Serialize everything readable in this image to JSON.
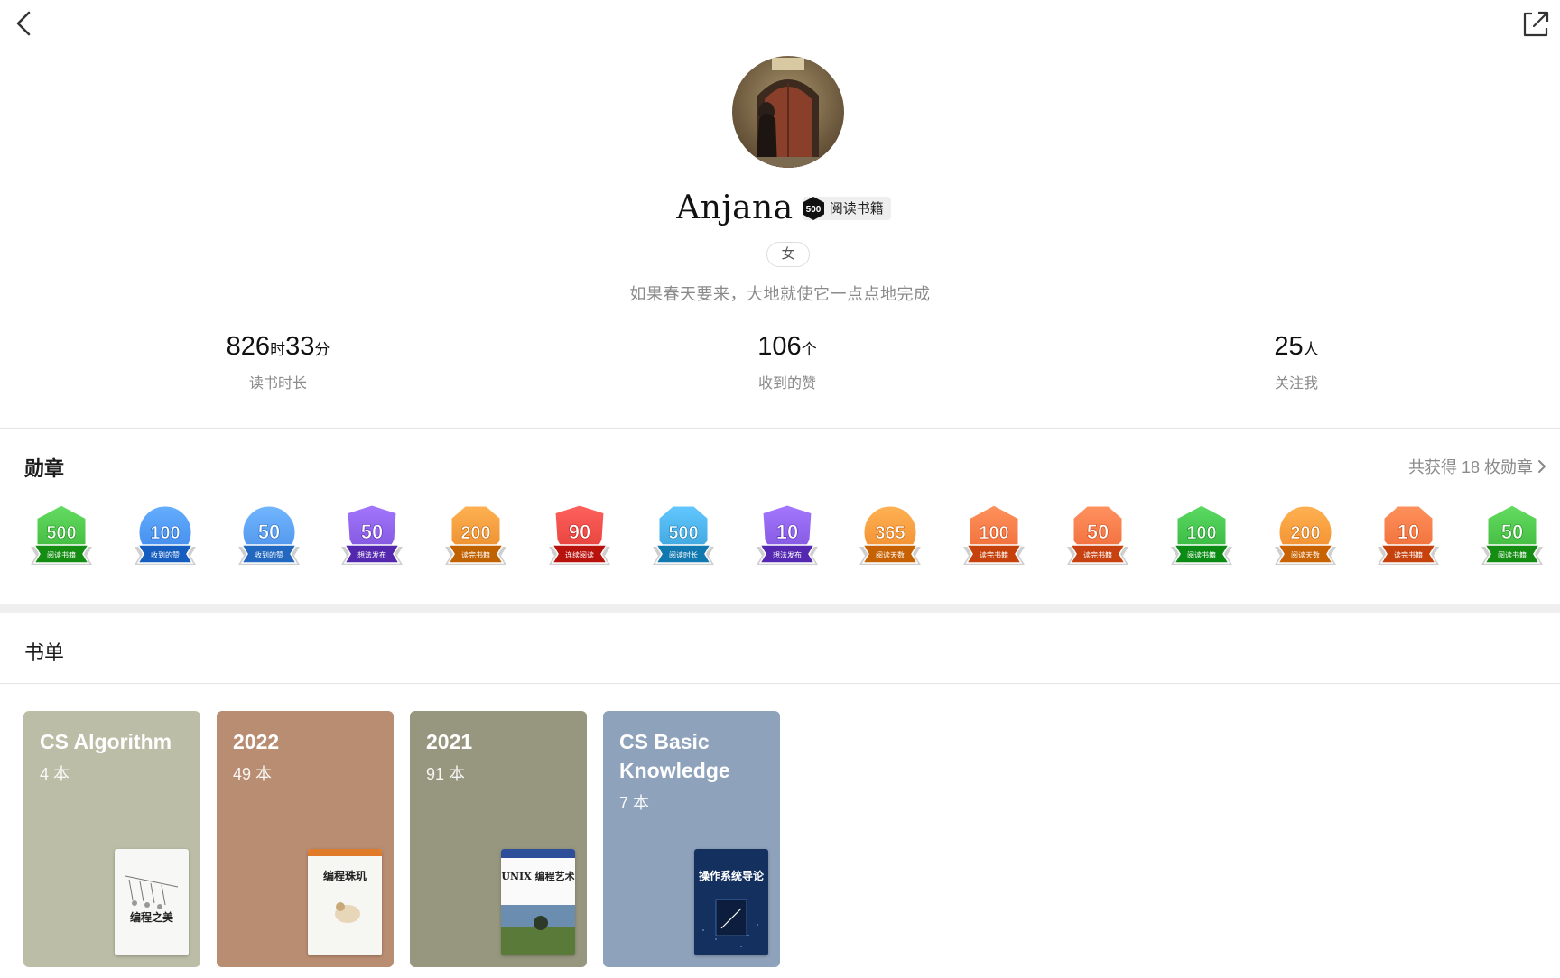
{
  "profile": {
    "name": "Anjana",
    "badge_number": "500",
    "badge_label": "阅读书籍",
    "gender": "女",
    "motto": "如果春天要来，大地就使它一点点地完成"
  },
  "stats": [
    {
      "value": "826",
      "unit1": "时",
      "value2": "33",
      "unit2": "分",
      "label": "读书时长"
    },
    {
      "value": "106",
      "unit1": "个",
      "label": "收到的赞"
    },
    {
      "value": "25",
      "unit1": "人",
      "label": "关注我"
    }
  ],
  "medals_section": {
    "title": "勋章",
    "summary": "共获得 18 枚勋章",
    "items": [
      {
        "number": "500",
        "label": "阅读书籍",
        "color": "#3db53a",
        "shape": "hexagon"
      },
      {
        "number": "100",
        "label": "收到的赞",
        "color": "#3d86e8",
        "shape": "circle"
      },
      {
        "number": "50",
        "label": "收到的赞",
        "color": "#4a8fe8",
        "shape": "circle"
      },
      {
        "number": "50",
        "label": "想法发布",
        "color": "#7b4fd6",
        "shape": "shield"
      },
      {
        "number": "200",
        "label": "读完书籍",
        "color": "#e98a2a",
        "shape": "octagon"
      },
      {
        "number": "90",
        "label": "连续阅读",
        "color": "#e03a35",
        "shape": "shield"
      },
      {
        "number": "500",
        "label": "阅读时长",
        "color": "#3aa0d8",
        "shape": "octagon"
      },
      {
        "number": "10",
        "label": "想法发布",
        "color": "#7c50d8",
        "shape": "shield"
      },
      {
        "number": "365",
        "label": "阅读天数",
        "color": "#ef8a2c",
        "shape": "circle"
      },
      {
        "number": "100",
        "label": "读完书籍",
        "color": "#ee6a35",
        "shape": "hexagon"
      },
      {
        "number": "50",
        "label": "读完书籍",
        "color": "#ef6a38",
        "shape": "octagon"
      },
      {
        "number": "100",
        "label": "阅读书籍",
        "color": "#34b33c",
        "shape": "hexagon"
      },
      {
        "number": "200",
        "label": "阅读天数",
        "color": "#f08a2a",
        "shape": "circle"
      },
      {
        "number": "10",
        "label": "读完书籍",
        "color": "#ee6a35",
        "shape": "octagon"
      },
      {
        "number": "50",
        "label": "阅读书籍",
        "color": "#3cb53a",
        "shape": "hexagon"
      }
    ]
  },
  "booklists_section": {
    "title": "书单",
    "items": [
      {
        "title": "CS Algorithm",
        "count": "4 本",
        "bg": "#bbbda6",
        "cover_title": "编程之美",
        "cover_bg": "#f7f7f5"
      },
      {
        "title": "2022",
        "count": "49 本",
        "bg": "#b88d72",
        "cover_title": "编程珠玑",
        "cover_bg": "#f6f6f3"
      },
      {
        "title": "2021",
        "count": "91 本",
        "bg": "#97977f",
        "cover_title": "UNIX 编程艺术",
        "cover_bg": "#fafafa"
      },
      {
        "title": "CS Basic Knowledge",
        "count": "7 本",
        "bg": "#8ea2bb",
        "cover_title": "操作系统导论",
        "cover_bg": "#14305f"
      }
    ]
  },
  "icons": {
    "back": "chevron-left-icon",
    "share": "external-link-icon",
    "more": "chevron-right-icon"
  }
}
